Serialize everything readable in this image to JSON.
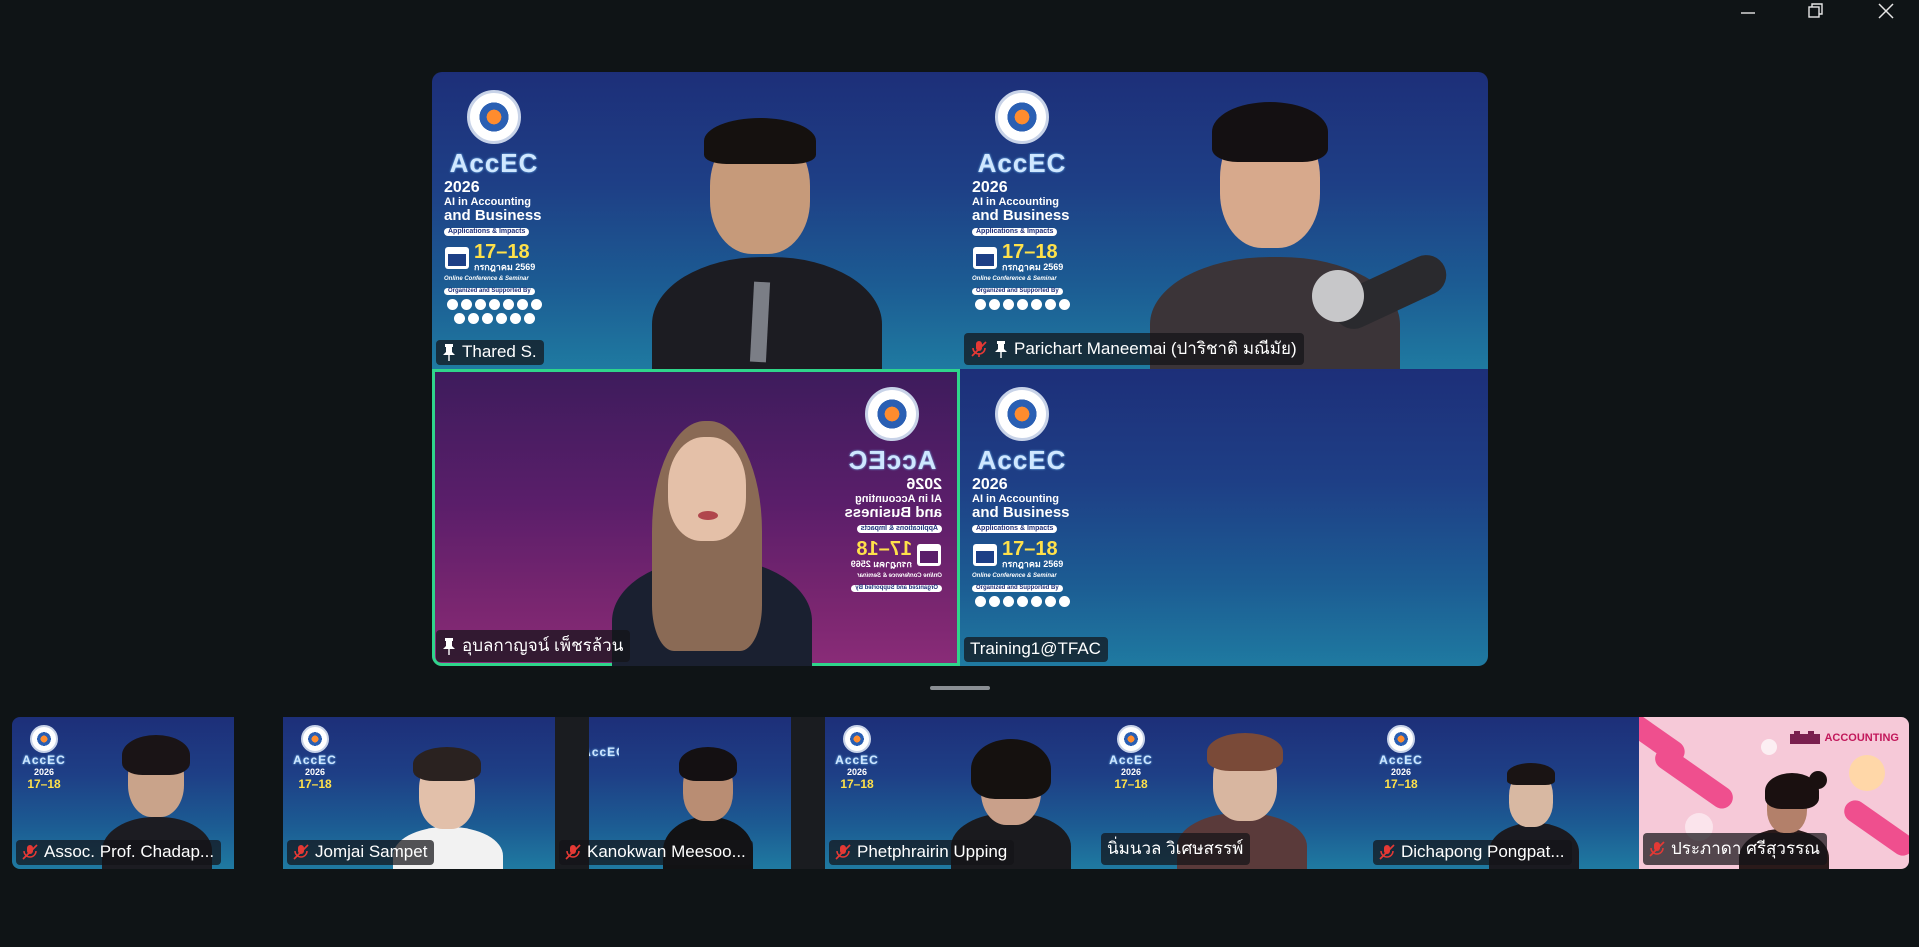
{
  "window_controls": {
    "minimize": "minimize-icon",
    "restore": "restore-icon",
    "close": "close-icon"
  },
  "poster": {
    "brand": "AccEC",
    "year": "2026",
    "line1": "AI in Accounting",
    "line2": "and Business",
    "tag": "Applications & Impacts",
    "dates": "17–18",
    "month": "กรกฎาคม 2569",
    "online": "Online Conference & Seminar",
    "org": "Organized and Supported By"
  },
  "main_tiles": [
    {
      "name": "Thared S.",
      "pinned": true,
      "muted": false
    },
    {
      "name": "Parichart Maneemai (ปาริชาติ มณีมัย)",
      "pinned": true,
      "muted": true
    },
    {
      "name": "อุบลกาญจน์ เพ็ชรล้วน",
      "pinned": true,
      "muted": false,
      "active": true
    },
    {
      "name": "Training1@TFAC",
      "pinned": false,
      "muted": false
    }
  ],
  "strip_tiles": [
    {
      "name": "Assoc. Prof. Chadap...",
      "muted": true
    },
    {
      "name": "Jomjai Sampet",
      "muted": true
    },
    {
      "name": "Kanokwan Meesoo...",
      "muted": true
    },
    {
      "name": "Phetphrairin Upping",
      "muted": true
    },
    {
      "name": "นิ่มนวล วิเศษสรรพ์",
      "muted": false
    },
    {
      "name": "Dichapong Pongpat...",
      "muted": true
    },
    {
      "name": "ประภาดา ศรีสุวรรณ",
      "muted": true
    }
  ],
  "pink_logo": "ACCOUNTING",
  "colors": {
    "active_border": "#2fd58b",
    "muted": "#e53935",
    "bg": "#0f1416"
  }
}
